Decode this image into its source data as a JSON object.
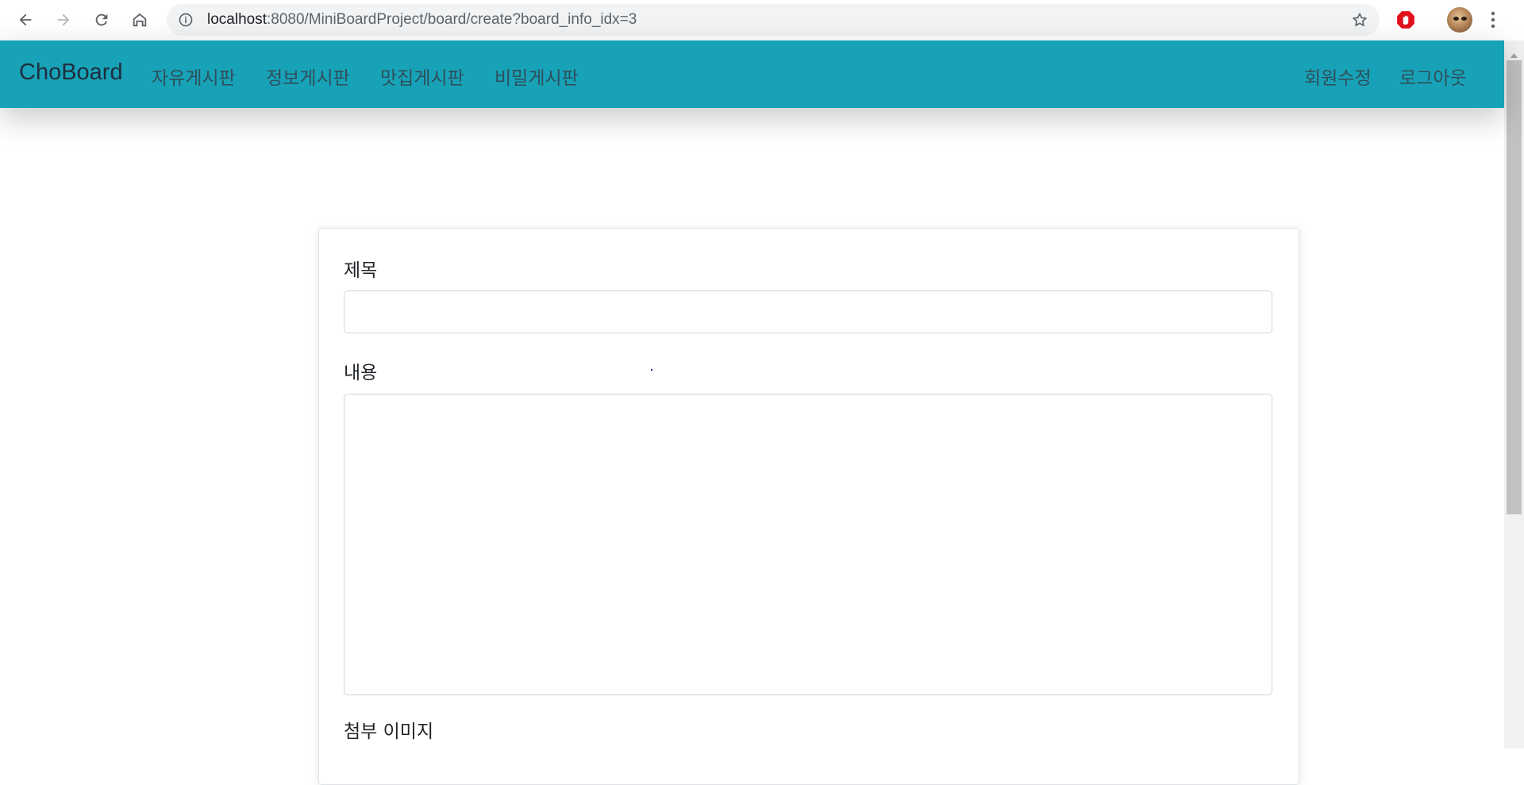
{
  "browser": {
    "url_host": "localhost",
    "url_rest": ":8080/MiniBoardProject/board/create?board_info_idx=3"
  },
  "navbar": {
    "brand": "ChoBoard",
    "left_links": [
      "자유게시판",
      "정보게시판",
      "맛집게시판",
      "비밀게시판"
    ],
    "right_links": [
      "회원수정",
      "로그아웃"
    ],
    "background_color": "#17a2b8"
  },
  "form": {
    "title_label": "제목",
    "title_value": "",
    "content_label": "내용",
    "content_value": "",
    "image_label": "첨부 이미지"
  },
  "icons": {
    "back": "arrow-left-icon",
    "forward": "arrow-right-icon",
    "reload": "reload-icon",
    "home": "home-icon",
    "info": "info-icon",
    "bookmark": "star-icon",
    "extension": "adblock-icon",
    "menu": "kebab-menu-icon"
  }
}
